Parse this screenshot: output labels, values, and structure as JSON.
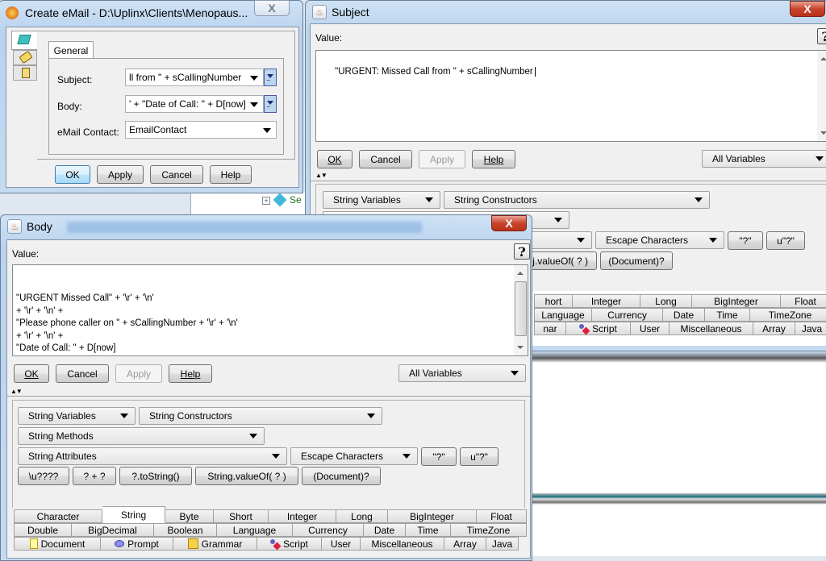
{
  "background_window": {
    "tree_item_label": "Se"
  },
  "create_email": {
    "title": "Create eMail - D:\\Uplinx\\Clients\\Menopaus...",
    "close_label": "X",
    "side_tabs": [
      "email-settings-icon",
      "tag-icon",
      "document-icon"
    ],
    "tab_label": "General",
    "fields": {
      "subject_label": "Subject:",
      "subject_value": "ll from \" + sCallingNumber",
      "body_label": "Body:",
      "body_value": "' + \"Date of Call: \" + D[now]",
      "contact_label": "eMail Contact:",
      "contact_value": "EmailContact"
    },
    "buttons": {
      "ok": "OK",
      "apply": "Apply",
      "cancel": "Cancel",
      "help": "Help"
    }
  },
  "subject_dialog": {
    "title": "Subject",
    "close_label": "X",
    "value_label": "Value:",
    "help_label": "?",
    "value_text": "\"URGENT: Missed Call from \" + sCallingNumber",
    "buttons": {
      "ok": "OK",
      "cancel": "Cancel",
      "apply": "Apply",
      "help": "Help"
    },
    "variables_combo": "All Variables",
    "splitter": "▲▼",
    "row1": {
      "string_variables": "String Variables",
      "string_constructors": "String Constructors"
    },
    "row3": {
      "escape_characters": "Escape Characters",
      "quote": "\"?\"",
      "uquote": "u\"?\""
    },
    "row4": {
      "value_of_partial": "j.valueOf( ? )",
      "document_cast": "(Document)?"
    },
    "tabs_row1": [
      "hort",
      "Integer",
      "Long",
      "BigInteger",
      "Float"
    ],
    "tabs_row2": [
      "Language",
      "Currency",
      "Date",
      "Time",
      "TimeZone"
    ],
    "tabs_row3": [
      "nar",
      "Script",
      "User",
      "Miscellaneous",
      "Array",
      "Java"
    ]
  },
  "body_dialog": {
    "title": "Body",
    "close_label": "X",
    "value_label": "Value:",
    "help_label": "?",
    "value_lines": [
      "\"URGENT Missed Call\" + '\\r' + '\\n'",
      "+ '\\r' + '\\n' +",
      "\"Please phone caller on \" + sCallingNumber + '\\r' + '\\n'",
      "+ '\\r' + '\\n' +",
      "\"Date of Call: \" + D[now]",
      "",
      "|"
    ],
    "buttons": {
      "ok": "OK",
      "cancel": "Cancel",
      "apply": "Apply",
      "help": "Help"
    },
    "variables_combo": "All Variables",
    "splitter": "▲▼",
    "builder": {
      "string_variables": "String Variables",
      "string_constructors": "String Constructors",
      "string_methods": "String Methods",
      "string_attributes": "String Attributes",
      "escape_characters": "Escape Characters",
      "quote": "\"?\"",
      "uquote": "u\"?\"",
      "unicode": "\\u????",
      "concat": "? + ?",
      "to_string": "?.toString()",
      "value_of": "String.valueOf( ? )",
      "document_cast": "(Document)?"
    },
    "tabs_row1": [
      "Character",
      "String",
      "Byte",
      "Short",
      "Integer",
      "Long",
      "BigInteger",
      "Float"
    ],
    "tabs_row2": [
      "Double",
      "BigDecimal",
      "Boolean",
      "Language",
      "Currency",
      "Date",
      "Time",
      "TimeZone"
    ],
    "tabs_row3": [
      "Document",
      "Prompt",
      "Grammar",
      "Script",
      "User",
      "Miscellaneous",
      "Array",
      "Java"
    ],
    "selected_tab": "String"
  }
}
